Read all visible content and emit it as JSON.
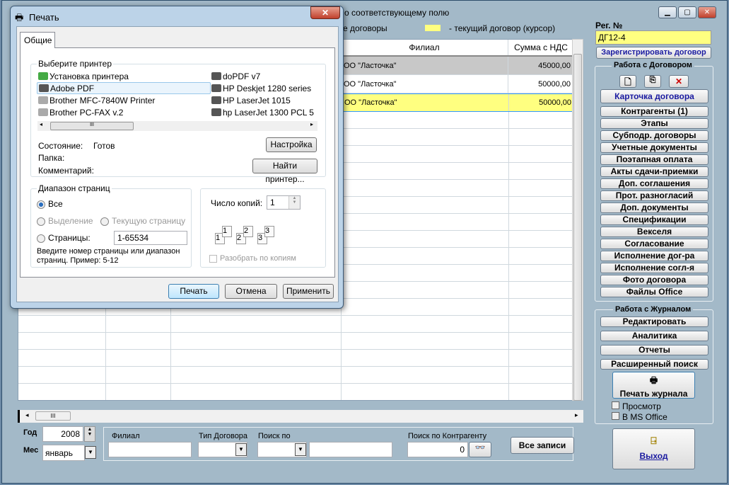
{
  "main": {
    "title_fragment": "о соответствующему полю",
    "legend_left": "е договоры",
    "legend_yellow": "- текущий договор (курсор)",
    "colors": {
      "current": "#ffff80",
      "selected": "#c8c8c8",
      "bg": "#a3b9c8"
    },
    "grid": {
      "headers": [
        "Филиал",
        "Сумма с НДС"
      ],
      "rows": [
        [
          "ОО \"Ласточка\"",
          "45000,00"
        ],
        [
          "ОО \"Ласточка\"",
          "50000,00"
        ],
        [
          "ОО \"Ласточка\"",
          "50000,00"
        ]
      ]
    },
    "hscroll": "III"
  },
  "right": {
    "reg_label": "Рег. №",
    "reg_value": "ДГ12-4",
    "register_button": "Зарегистрировать договор",
    "contract_group": "Работа с Договором",
    "card_button": "Карточка договора",
    "buttons": [
      "Контрагенты (1)",
      "Этапы",
      "Субподр. договоры",
      "Учетные документы",
      "Поэтапная оплата",
      "Акты сдачи-приемки",
      "Доп. соглашения",
      "Прот. разногласий",
      "Доп. документы",
      "Спецификации",
      "Векселя",
      "Согласование",
      "Исполнение дог-ра",
      "Исполнение согл-я",
      "Фото договора",
      "Файлы Office"
    ],
    "journal_group": "Работа с Журналом",
    "journal_buttons": [
      "Редактировать",
      "Аналитика",
      "Отчеты",
      "Расширенный поиск"
    ],
    "print_journal": "Печать журнала",
    "preview": "Просмотр",
    "ms_office": "В MS Office",
    "exit": "Выход"
  },
  "bottom": {
    "year_label": "Год",
    "year": "2008",
    "month_label": "Мес",
    "month": "январь",
    "branch_label": "Филиал",
    "type_label": "Тип Договора",
    "search_by_label": "Поиск по",
    "counterparty_label": "Поиск по Контрагенту",
    "counterparty_value": "0",
    "all_records": "Все записи"
  },
  "dialog": {
    "title": "Печать",
    "tab": "Общие",
    "printer_group": "Выберите принтер",
    "printers_left": [
      "Установка принтера",
      "Adobe PDF",
      "Brother MFC-7840W Printer",
      "Brother PC-FAX v.2"
    ],
    "printers_right": [
      "doPDF v7",
      "HP Deskjet 1280 series",
      "HP LaserJet 1015",
      "hp LaserJet 1300 PCL 5"
    ],
    "status_label": "Состояние:",
    "status_value": "Готов",
    "folder_label": "Папка:",
    "comment_label": "Комментарий:",
    "settings_button": "Настройка",
    "find_button": "Найти принтер...",
    "range_group": "Диапазон страниц",
    "all": "Все",
    "selection": "Выделение",
    "current_page": "Текущую страницу",
    "pages": "Страницы:",
    "pages_value": "1-65534",
    "hint": "Введите номер страницы или диапазон страниц.  Пример: 5-12",
    "copies_label": "Число копий:",
    "copies": "1",
    "collate": "Разобрать по копиям",
    "collate_digits": [
      "1",
      "1",
      "2",
      "2",
      "3",
      "3"
    ],
    "print": "Печать",
    "cancel": "Отмена",
    "apply": "Применить"
  }
}
